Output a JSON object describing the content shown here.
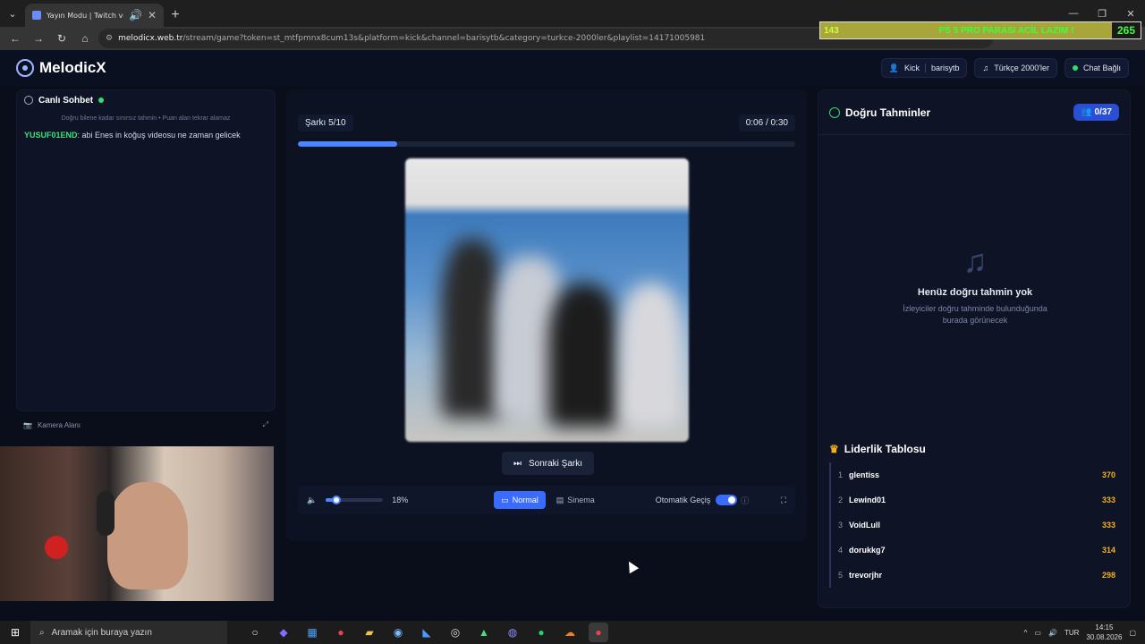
{
  "browser": {
    "tab_title": "Yayın Modu | Twitch ve Kick",
    "url_host": "melodicx.web.tr",
    "url_path": "/stream/game?token=st_mtfpmnx8cum13s&platform=kick&channel=barisytb&category=turkce-2000ler&playlist=14171005981"
  },
  "stream_banner": {
    "left_num": "143",
    "message": "PS 5 PRO PARASI ACİL LAZIM !",
    "right_num": "265"
  },
  "header": {
    "logo": "MelodicX",
    "platform": "Kick",
    "channel": "barisytb",
    "category": "Türkçe 2000'ler",
    "chat_status": "Chat Bağlı"
  },
  "chat": {
    "title": "Canlı Sohbet",
    "hint": "Doğru bilene kadar sınırsız tahmin • Puan alan tekrar alamaz",
    "messages": [
      {
        "user": "YUSUF01END",
        "text": ": abi Enes in koğuş videosu ne zaman gelicek"
      }
    ]
  },
  "camera": {
    "label": "Kamera Alanı"
  },
  "player": {
    "song_counter": "Şarkı 5/10",
    "time_current": "0:06",
    "time_separator": "/",
    "time_total": "0:30",
    "progress": 0.2,
    "next_button": "Sonraki Şarkı",
    "volume": 0.18,
    "volume_label": "18%",
    "mode_normal": "Normal",
    "mode_cinema": "Sinema",
    "auto_switch_label": "Otomatik Geçiş",
    "auto_switch_on": true
  },
  "guesses": {
    "title": "Doğru Tahminler",
    "count": "0/37",
    "empty_title": "Henüz doğru tahmin yok",
    "empty_sub_1": "İzleyiciler doğru tahminde bulunduğunda",
    "empty_sub_2": "burada görünecek"
  },
  "leaderboard": {
    "title": "Liderlik Tablosu",
    "rows": [
      {
        "rank": "1",
        "name": "glentiss",
        "score": "370"
      },
      {
        "rank": "2",
        "name": "Lewind01",
        "score": "333"
      },
      {
        "rank": "3",
        "name": "VoidLull",
        "score": "333"
      },
      {
        "rank": "4",
        "name": "dorukkg7",
        "score": "314"
      },
      {
        "rank": "5",
        "name": "trevorjhr",
        "score": "298"
      }
    ]
  },
  "taskbar": {
    "search_placeholder": "Aramak için buraya yazın",
    "lang": "TUR",
    "time": "14:15",
    "date": "30.08.2026"
  },
  "colors": {
    "accent": "#4d84ff",
    "score": "#f2b01e",
    "online": "#2ee06a",
    "bg": "#0a0e1a"
  }
}
